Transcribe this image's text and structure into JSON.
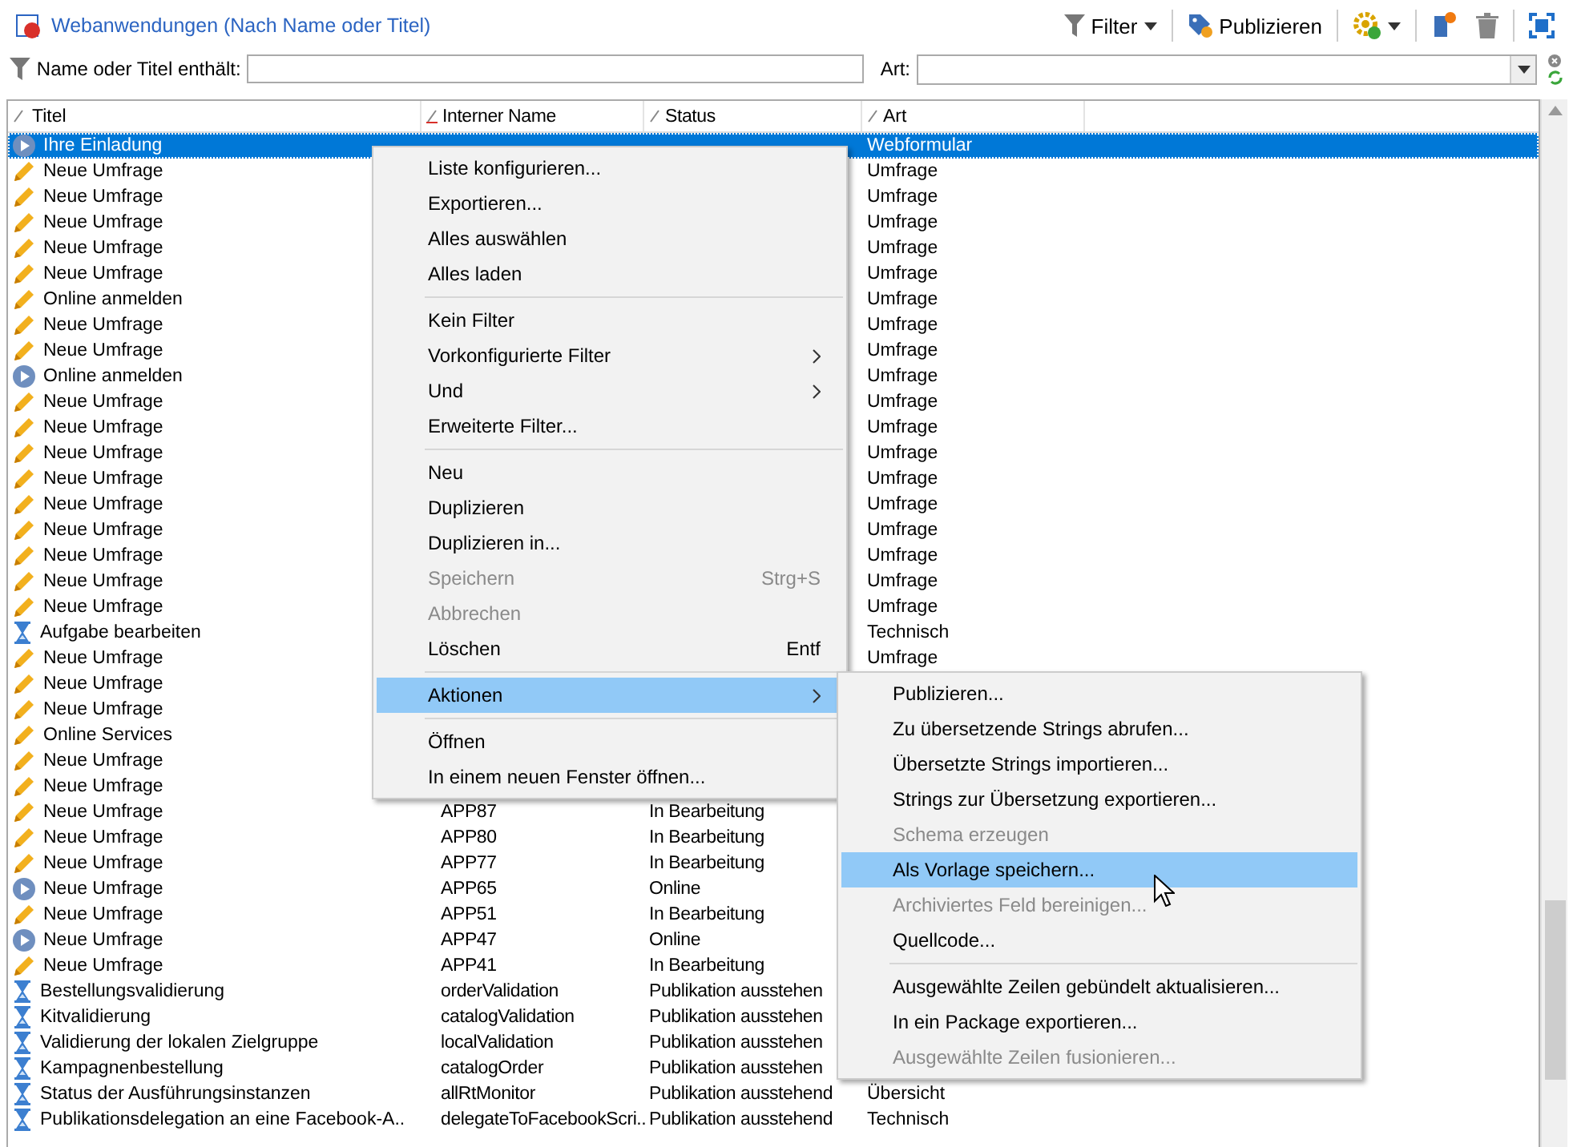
{
  "header": {
    "title": "Webanwendungen (Nach Name oder Titel)"
  },
  "toolbar": [
    {
      "kind": "dropdown",
      "label": "Filter"
    },
    {
      "kind": "publish",
      "label": "Publizieren"
    },
    {
      "kind": "gear"
    },
    {
      "kind": "new"
    },
    {
      "kind": "delete"
    },
    {
      "kind": "maximize"
    }
  ],
  "filter_bar": {
    "label": "Name oder Titel enthält:",
    "type_label": "Art:"
  },
  "table": {
    "columns": [
      {
        "label": "Titel",
        "sorted": false
      },
      {
        "label": "Interner Name",
        "sorted": true
      },
      {
        "label": "Status",
        "sorted": false
      },
      {
        "label": "Art",
        "sorted": false
      }
    ],
    "rows": [
      {
        "kind": "play",
        "title": "Ihre Einladung",
        "type": "Webformular",
        "selected": true
      },
      {
        "kind": "pencil",
        "title": "Neue Umfrage",
        "type": "Umfrage",
        "selected": false
      },
      {
        "kind": "pencil",
        "title": "Neue Umfrage",
        "type": "Umfrage",
        "selected": false
      },
      {
        "kind": "pencil",
        "title": "Neue Umfrage",
        "type": "Umfrage",
        "selected": false
      },
      {
        "kind": "pencil",
        "title": "Neue Umfrage",
        "type": "Umfrage",
        "selected": false
      },
      {
        "kind": "pencil",
        "title": "Neue Umfrage",
        "type": "Umfrage",
        "selected": false
      },
      {
        "kind": "pencil",
        "title": "Online anmelden",
        "type": "Umfrage",
        "selected": false
      },
      {
        "kind": "pencil",
        "title": "Neue Umfrage",
        "type": "Umfrage",
        "selected": false
      },
      {
        "kind": "pencil",
        "title": "Neue Umfrage",
        "type": "Umfrage",
        "selected": false
      },
      {
        "kind": "play",
        "title": "Online anmelden",
        "type": "Umfrage",
        "selected": false
      },
      {
        "kind": "pencil",
        "title": "Neue Umfrage",
        "type": "Umfrage",
        "selected": false
      },
      {
        "kind": "pencil",
        "title": "Neue Umfrage",
        "type": "Umfrage",
        "selected": false
      },
      {
        "kind": "pencil",
        "title": "Neue Umfrage",
        "type": "Umfrage",
        "selected": false
      },
      {
        "kind": "pencil",
        "title": "Neue Umfrage",
        "type": "Umfrage",
        "selected": false
      },
      {
        "kind": "pencil",
        "title": "Neue Umfrage",
        "type": "Umfrage",
        "selected": false
      },
      {
        "kind": "pencil",
        "title": "Neue Umfrage",
        "type": "Umfrage",
        "selected": false
      },
      {
        "kind": "pencil",
        "title": "Neue Umfrage",
        "type": "Umfrage",
        "selected": false
      },
      {
        "kind": "pencil",
        "title": "Neue Umfrage",
        "type": "Umfrage",
        "selected": false
      },
      {
        "kind": "pencil",
        "title": "Neue Umfrage",
        "type": "Umfrage",
        "selected": false
      },
      {
        "kind": "hourglass",
        "title": "Aufgabe bearbeiten",
        "type": "Technisch",
        "selected": false
      },
      {
        "kind": "pencil",
        "title": "Neue Umfrage",
        "type": "Umfrage",
        "selected": false
      },
      {
        "kind": "pencil",
        "title": "Neue Umfrage",
        "selected": false
      },
      {
        "kind": "pencil",
        "title": "Neue Umfrage",
        "selected": false
      },
      {
        "kind": "pencil",
        "title": "Online Services",
        "selected": false
      },
      {
        "kind": "pencil",
        "title": "Neue Umfrage",
        "selected": false
      },
      {
        "kind": "pencil",
        "title": "Neue Umfrage",
        "selected": false
      },
      {
        "kind": "pencil",
        "title": "Neue Umfrage",
        "internal_name": "APP87",
        "status": "In Bearbeitung",
        "selected": false
      },
      {
        "kind": "pencil",
        "title": "Neue Umfrage",
        "internal_name": "APP80",
        "status": "In Bearbeitung",
        "selected": false
      },
      {
        "kind": "pencil",
        "title": "Neue Umfrage",
        "internal_name": "APP77",
        "status": "In Bearbeitung",
        "selected": false
      },
      {
        "kind": "play",
        "title": "Neue Umfrage",
        "internal_name": "APP65",
        "status": "Online",
        "selected": false
      },
      {
        "kind": "pencil",
        "title": "Neue Umfrage",
        "internal_name": "APP51",
        "status": "In Bearbeitung",
        "selected": false
      },
      {
        "kind": "play",
        "title": "Neue Umfrage",
        "internal_name": "APP47",
        "status": "Online",
        "selected": false
      },
      {
        "kind": "pencil",
        "title": "Neue Umfrage",
        "internal_name": "APP41",
        "status": "In Bearbeitung",
        "selected": false
      },
      {
        "kind": "hourglass",
        "title": "Bestellungsvalidierung",
        "internal_name": "orderValidation",
        "status": "Publikation ausstehen",
        "selected": false
      },
      {
        "kind": "hourglass",
        "title": "Kitvalidierung",
        "internal_name": "catalogValidation",
        "status": "Publikation ausstehen",
        "selected": false
      },
      {
        "kind": "hourglass",
        "title": "Validierung der lokalen Zielgruppe",
        "internal_name": "localValidation",
        "status": "Publikation ausstehen",
        "selected": false
      },
      {
        "kind": "hourglass",
        "title": "Kampagnenbestellung",
        "internal_name": "catalogOrder",
        "status": "Publikation ausstehen",
        "selected": false
      },
      {
        "kind": "hourglass",
        "title": "Status der Ausführungsinstanzen",
        "internal_name": "allRtMonitor",
        "status": "Publikation ausstehend",
        "type": "Übersicht",
        "selected": false
      },
      {
        "kind": "hourglass",
        "title": "Publikationsdelegation an eine Facebook-A..",
        "internal_name": "delegateToFacebookScri..",
        "status": "Publikation ausstehend",
        "type": "Technisch",
        "selected": false
      }
    ]
  },
  "context_menu": {
    "items": [
      {
        "kind": "item",
        "label": "Liste konfigurieren...",
        "disabled": false,
        "has_submenu": false,
        "selected": false
      },
      {
        "kind": "item",
        "label": "Exportieren...",
        "disabled": false,
        "has_submenu": false,
        "selected": false
      },
      {
        "kind": "item",
        "label": "Alles auswählen",
        "disabled": false,
        "has_submenu": false,
        "selected": false
      },
      {
        "kind": "item",
        "label": "Alles laden",
        "disabled": false,
        "has_submenu": false,
        "selected": false
      },
      {
        "kind": "separator"
      },
      {
        "kind": "item",
        "label": "Kein Filter",
        "disabled": false,
        "has_submenu": false,
        "selected": false
      },
      {
        "kind": "item",
        "label": "Vorkonfigurierte Filter",
        "disabled": false,
        "has_submenu": true,
        "selected": false
      },
      {
        "kind": "item",
        "label": "Und",
        "disabled": false,
        "has_submenu": true,
        "selected": false
      },
      {
        "kind": "item",
        "label": "Erweiterte Filter...",
        "disabled": false,
        "has_submenu": false,
        "selected": false
      },
      {
        "kind": "separator"
      },
      {
        "kind": "item",
        "label": "Neu",
        "disabled": false,
        "has_submenu": false,
        "selected": false
      },
      {
        "kind": "item",
        "label": "Duplizieren",
        "disabled": false,
        "has_submenu": false,
        "selected": false
      },
      {
        "kind": "item",
        "label": "Duplizieren in...",
        "disabled": false,
        "has_submenu": false,
        "selected": false
      },
      {
        "kind": "item",
        "label": "Speichern",
        "shortcut": "Strg+S",
        "disabled": true,
        "has_submenu": false,
        "selected": false
      },
      {
        "kind": "item",
        "label": "Abbrechen",
        "disabled": true,
        "has_submenu": false,
        "selected": false
      },
      {
        "kind": "item",
        "label": "Löschen",
        "shortcut": "Entf",
        "disabled": false,
        "has_submenu": false,
        "selected": false
      },
      {
        "kind": "separator"
      },
      {
        "kind": "item",
        "label": "Aktionen",
        "disabled": false,
        "has_submenu": true,
        "selected": true
      },
      {
        "kind": "separator"
      },
      {
        "kind": "item",
        "label": "Öffnen",
        "disabled": false,
        "has_submenu": false,
        "selected": false
      },
      {
        "kind": "item",
        "label": "In einem neuen Fenster öffnen...",
        "disabled": false,
        "has_submenu": false,
        "selected": false
      }
    ]
  },
  "submenu": {
    "items": [
      {
        "kind": "item",
        "label": "Publizieren...",
        "disabled": false,
        "has_submenu": false,
        "selected": false
      },
      {
        "kind": "item",
        "label": "Zu übersetzende Strings abrufen...",
        "disabled": false,
        "has_submenu": false,
        "selected": false
      },
      {
        "kind": "item",
        "label": "Übersetzte Strings importieren...",
        "disabled": false,
        "has_submenu": false,
        "selected": false
      },
      {
        "kind": "item",
        "label": "Strings zur Übersetzung exportieren...",
        "disabled": false,
        "has_submenu": false,
        "selected": false
      },
      {
        "kind": "item",
        "label": "Schema erzeugen",
        "disabled": true,
        "has_submenu": false,
        "selected": false
      },
      {
        "kind": "item",
        "label": "Als Vorlage speichern...",
        "disabled": false,
        "has_submenu": false,
        "selected": true
      },
      {
        "kind": "item",
        "label": "Archiviertes Feld bereinigen...",
        "disabled": true,
        "has_submenu": false,
        "selected": false
      },
      {
        "kind": "item",
        "label": "Quellcode...",
        "disabled": false,
        "has_submenu": false,
        "selected": false
      },
      {
        "kind": "separator"
      },
      {
        "kind": "item",
        "label": "Ausgewählte Zeilen gebündelt aktualisieren...",
        "disabled": false,
        "has_submenu": false,
        "selected": false
      },
      {
        "kind": "item",
        "label": "In ein Package exportieren...",
        "disabled": false,
        "has_submenu": false,
        "selected": false
      },
      {
        "kind": "item",
        "label": "Ausgewählte Zeilen fusionieren...",
        "disabled": true,
        "has_submenu": false,
        "selected": false
      }
    ]
  }
}
